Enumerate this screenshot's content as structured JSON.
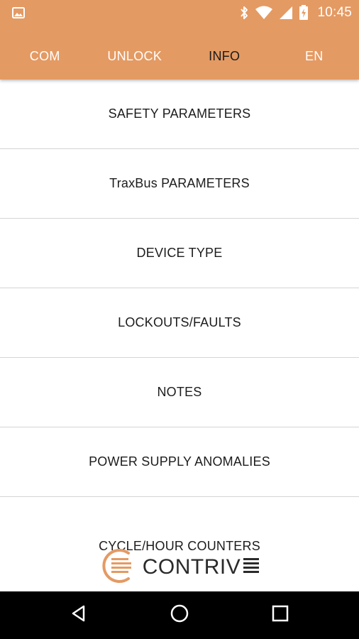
{
  "status_bar": {
    "time": "10:45",
    "icons": [
      "image-icon",
      "bluetooth-icon",
      "wifi-icon",
      "signal-icon",
      "battery-charging-icon"
    ]
  },
  "tabs": [
    {
      "label": "COM",
      "active": false
    },
    {
      "label": "UNLOCK",
      "active": false
    },
    {
      "label": "INFO",
      "active": true
    },
    {
      "label": "EN",
      "active": false
    }
  ],
  "menu": {
    "items": [
      {
        "label": "SAFETY PARAMETERS"
      },
      {
        "label": "TraxBus PARAMETERS"
      },
      {
        "label": "DEVICE TYPE"
      },
      {
        "label": "LOCKOUTS/FAULTS"
      },
      {
        "label": "NOTES"
      },
      {
        "label": "POWER SUPPLY ANOMALIES"
      },
      {
        "label": "CYCLE/HOUR COUNTERS"
      }
    ]
  },
  "logo": {
    "text": "CONTRIV"
  },
  "nav_bar": {
    "icons": [
      "back-icon",
      "home-icon",
      "recents-icon"
    ]
  },
  "colors": {
    "accent": "#e49a63",
    "active_tab_text": "#1b1b1b",
    "divider": "#d4d4d4"
  }
}
